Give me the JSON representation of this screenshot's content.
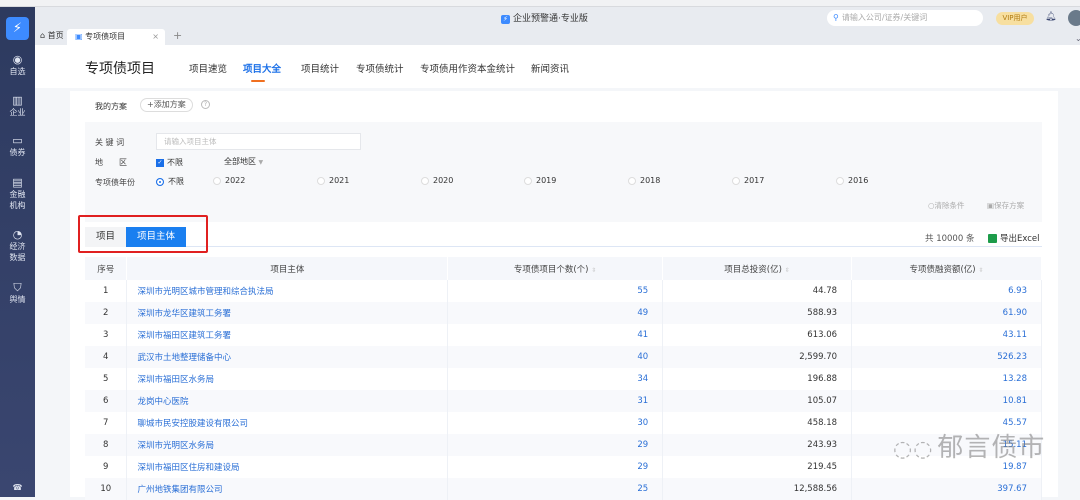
{
  "app": {
    "title": "企业预警通·专业版",
    "search_placeholder": "请输入公司/证券/关键词",
    "vip": "VIP用户"
  },
  "sidebar": {
    "items": [
      {
        "label": "自选",
        "icon": "bulb-icon"
      },
      {
        "label": "企业",
        "icon": "building-icon"
      },
      {
        "label": "债券",
        "icon": "bond-icon"
      },
      {
        "label": "金融\n机构",
        "icon": "bank-icon"
      },
      {
        "label": "经济\n数据",
        "icon": "chart-icon"
      },
      {
        "label": "舆情",
        "icon": "shield-icon"
      }
    ]
  },
  "tabs": {
    "home": "首页",
    "active": "专项债项目"
  },
  "header": {
    "title": "专项债项目",
    "nav": [
      "项目速览",
      "项目大全",
      "项目统计",
      "专项债统计",
      "专项债用作资本金统计",
      "新闻资讯"
    ],
    "active_index": 1
  },
  "plans": {
    "label": "我的方案",
    "add": "+添加方案"
  },
  "filters": {
    "keyword_label": "关 键 词",
    "keyword_placeholder": "请输入项目主体",
    "region_label": "地　　区",
    "region_unlimited": "不限",
    "region_select": "全部地区",
    "year_label": "专项债年份",
    "years": [
      "不限",
      "2022",
      "2021",
      "2020",
      "2019",
      "2018",
      "2017",
      "2016"
    ],
    "clear": "清除条件",
    "save": "保存方案"
  },
  "result_tabs": [
    "项目",
    "项目主体"
  ],
  "total": "共 10000 条",
  "export": "导出Excel",
  "table": {
    "headers": [
      "序号",
      "项目主体",
      "专项债项目个数(个)",
      "项目总投资(亿)",
      "专项债融资额(亿)"
    ],
    "rows": [
      [
        "1",
        "深圳市光明区城市管理和综合执法局",
        "55",
        "44.78",
        "6.93"
      ],
      [
        "2",
        "深圳市龙华区建筑工务署",
        "49",
        "588.93",
        "61.90"
      ],
      [
        "3",
        "深圳市福田区建筑工务署",
        "41",
        "613.06",
        "43.11"
      ],
      [
        "4",
        "武汉市土地整理储备中心",
        "40",
        "2,599.70",
        "526.23"
      ],
      [
        "5",
        "深圳市福田区水务局",
        "34",
        "196.88",
        "13.28"
      ],
      [
        "6",
        "龙岗中心医院",
        "31",
        "105.07",
        "10.81"
      ],
      [
        "7",
        "聊城市民安控股建设有限公司",
        "30",
        "458.18",
        "45.57"
      ],
      [
        "8",
        "深圳市光明区水务局",
        "29",
        "243.93",
        "15.11"
      ],
      [
        "9",
        "深圳市福田区住房和建设局",
        "29",
        "219.45",
        "19.87"
      ],
      [
        "10",
        "广州地铁集团有限公司",
        "25",
        "12,588.56",
        "397.67"
      ]
    ]
  },
  "watermark": "郁言债市"
}
